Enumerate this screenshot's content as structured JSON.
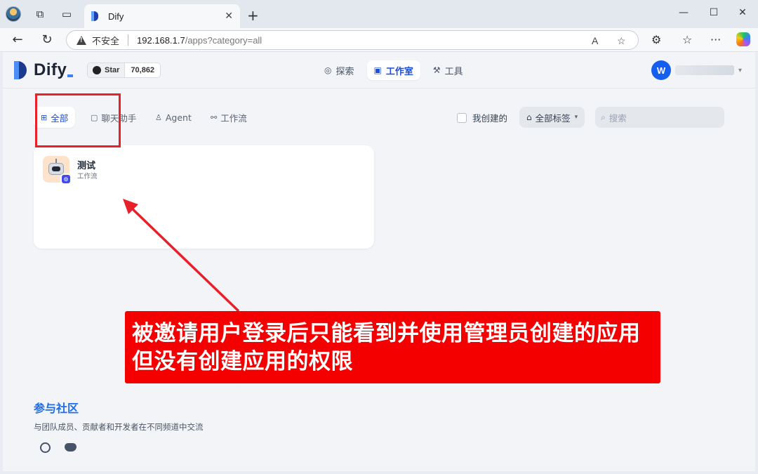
{
  "browser": {
    "tab_title": "Dify",
    "insecure_label": "不安全",
    "url_host": "192.168.1.7",
    "url_path": "/apps?category=all",
    "reader_icon": "A",
    "favorite_icon": "☆",
    "extensions_icon": "⚙",
    "favorites_icon": "☆",
    "more_icon": "···",
    "back_icon": "←",
    "refresh_icon": "↻",
    "newtab_icon": "+",
    "close_icon": "✕",
    "minimize_icon": "—",
    "maximize_icon": "☐"
  },
  "header": {
    "logo_text": "Dify",
    "github_star_label": "Star",
    "github_star_count": "70,862",
    "nav": [
      {
        "label": "探索",
        "icon": "explore-icon",
        "active": false
      },
      {
        "label": "工作室",
        "icon": "robot-icon",
        "active": true
      },
      {
        "label": "工具",
        "icon": "tools-icon",
        "active": false
      }
    ],
    "avatar_initial": "W"
  },
  "filters": {
    "categories": [
      {
        "label": "全部",
        "active": true
      },
      {
        "label": "聊天助手",
        "active": false
      },
      {
        "label": "Agent",
        "active": false
      },
      {
        "label": "工作流",
        "active": false
      }
    ],
    "my_created_label": "我创建的",
    "tags_label": "全部标签",
    "search_placeholder": "搜索"
  },
  "apps": [
    {
      "name": "测试",
      "type": "工作流"
    }
  ],
  "community": {
    "title": "参与社区",
    "description": "与团队成员、贡献者和开发者在不同频道中交流"
  },
  "annotation": {
    "line1": "被邀请用户登录后只能看到并使用管理员创建的应用",
    "line2": "但没有创建应用的权限",
    "color": "#f40000"
  },
  "colors": {
    "accent": "#1d4ed8",
    "brand_dark": "#1c3a8c",
    "annotation_red": "#e8202a"
  }
}
